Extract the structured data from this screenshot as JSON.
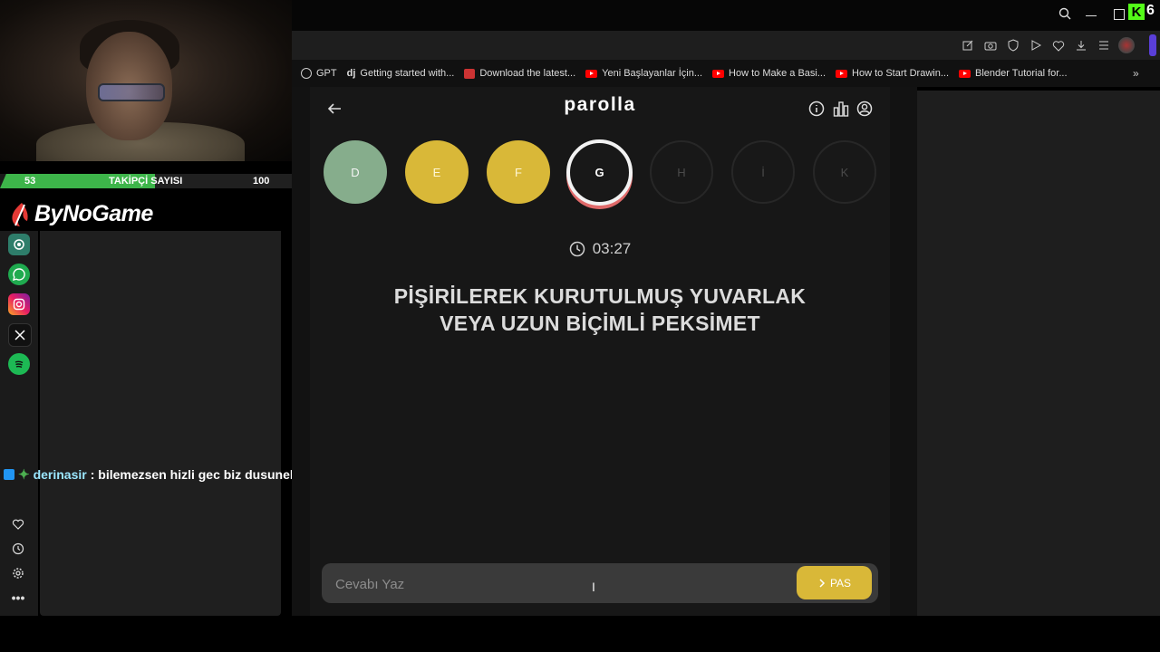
{
  "stream": {
    "follower_label": "TAKİPÇİ SAYISI",
    "follower_current": "53",
    "follower_goal": "100",
    "follower_progress": 0.53,
    "brand": "ByNoGame",
    "chat": {
      "user": "derinasir",
      "message": ": bilemezsen hizli gec biz dusunelim"
    },
    "accent_green": "#3db54a"
  },
  "browser": {
    "bookmarks": [
      {
        "icon": "gpt-icon",
        "label": "GPT"
      },
      {
        "icon": "dj-icon",
        "label": "Getting started with..."
      },
      {
        "icon": "download-site-icon",
        "label": "Download the latest..."
      },
      {
        "icon": "youtube-icon",
        "label": "Yeni Başlayanlar İçin..."
      },
      {
        "icon": "youtube-icon",
        "label": "How to Make a Basi..."
      },
      {
        "icon": "youtube-icon",
        "label": "How to Start Drawin..."
      },
      {
        "icon": "youtube-icon",
        "label": "Blender Tutorial for..."
      }
    ],
    "overlay_badge": "6"
  },
  "game": {
    "title": "parolla",
    "letters": [
      {
        "letter": "D",
        "state": "correct"
      },
      {
        "letter": "E",
        "state": "passed"
      },
      {
        "letter": "F",
        "state": "passed"
      },
      {
        "letter": "G",
        "state": "active"
      },
      {
        "letter": "H",
        "state": "pending"
      },
      {
        "letter": "İ",
        "state": "pending"
      },
      {
        "letter": "K",
        "state": "pending"
      }
    ],
    "timer": "03:27",
    "question_line1": "PİŞİRİLEREK KURUTULMUŞ YUVARLAK",
    "question_line2": "VEYA UZUN BİÇİMLİ PEKSİMET",
    "answer_placeholder": "Cevabı Yaz",
    "pass_label": "PAS",
    "colors": {
      "correct": "#86ad8c",
      "passed": "#d9b838",
      "active_ring": "#e06a6a"
    }
  }
}
